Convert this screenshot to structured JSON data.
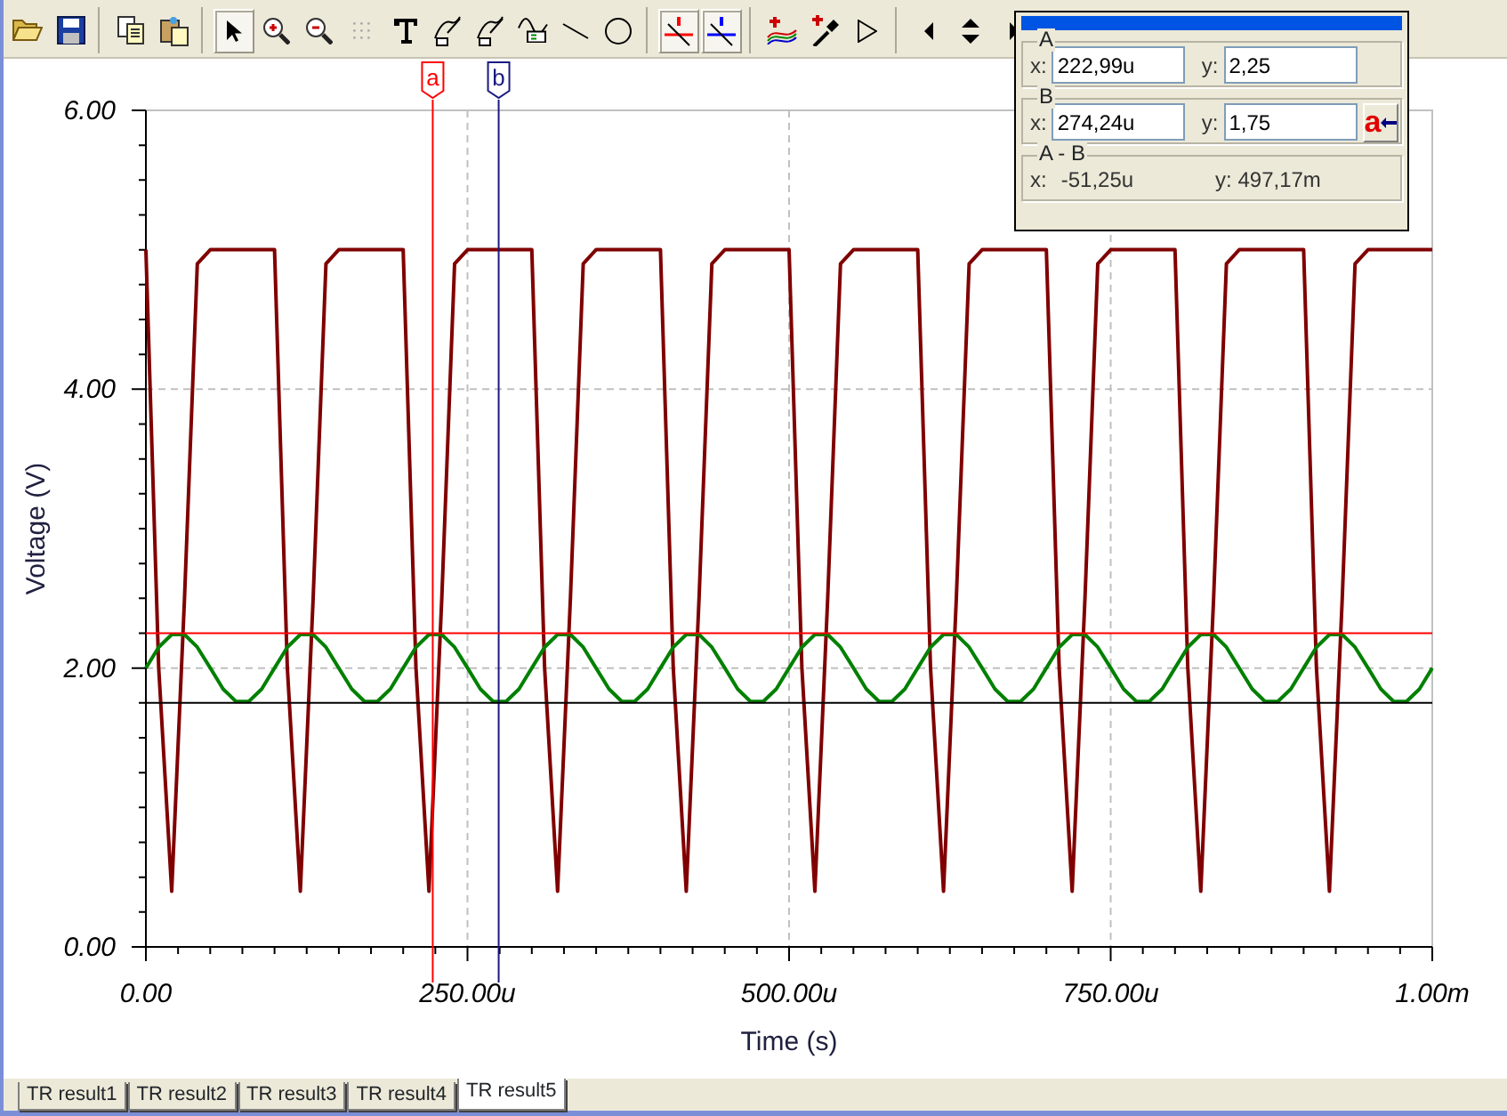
{
  "toolbar": [
    {
      "kind": "open",
      "selected": false
    },
    {
      "kind": "save",
      "selected": false
    },
    {
      "kind": "separator"
    },
    {
      "kind": "copy",
      "selected": false
    },
    {
      "kind": "paste",
      "selected": false
    },
    {
      "kind": "separator"
    },
    {
      "kind": "pointer",
      "selected": true
    },
    {
      "kind": "zoom-in",
      "selected": false
    },
    {
      "kind": "zoom-out",
      "selected": false
    },
    {
      "kind": "grid",
      "selected": false
    },
    {
      "kind": "text",
      "selected": false
    },
    {
      "kind": "label",
      "selected": false
    },
    {
      "kind": "label",
      "selected": false
    },
    {
      "kind": "label-wave",
      "selected": false
    },
    {
      "kind": "line",
      "selected": false
    },
    {
      "kind": "circle",
      "selected": false
    },
    {
      "kind": "separator"
    },
    {
      "kind": "cursor-a",
      "selected": true
    },
    {
      "kind": "cursor-b",
      "selected": true
    },
    {
      "kind": "separator"
    },
    {
      "kind": "add-trace",
      "selected": false
    },
    {
      "kind": "probe",
      "selected": false
    },
    {
      "kind": "triangle",
      "selected": false
    },
    {
      "kind": "separator"
    },
    {
      "kind": "left",
      "selected": false
    },
    {
      "kind": "updown",
      "selected": false
    },
    {
      "kind": "right",
      "selected": false
    }
  ],
  "cursor_panel": {
    "groups": [
      {
        "kind": "fields",
        "title": "A",
        "x_label": "x:",
        "x_value": "222,99u",
        "y_label": "y:",
        "y_value": "2,25"
      },
      {
        "kind": "fields",
        "title": "B",
        "x_label": "x:",
        "x_value": "274,24u",
        "y_label": "y:",
        "y_value": "1,75",
        "button": "a"
      },
      {
        "kind": "readout",
        "title": "A - B",
        "x_label": "x:",
        "x_value": "-51,25u",
        "y_label": "y:",
        "y_value": "497,17m"
      }
    ]
  },
  "chart": {
    "x_axis_end_label": "1.00m",
    "chart_data": {
      "type": "line",
      "xlabel": "Time (s)",
      "ylabel": "Voltage (V)",
      "x": [
        0,
        10,
        20,
        30,
        40,
        50,
        60,
        70,
        80,
        90,
        100,
        110,
        120,
        130,
        140,
        150,
        160,
        170,
        180,
        190,
        200,
        210,
        220,
        230,
        240,
        250,
        260,
        270,
        280,
        290,
        300,
        310,
        320,
        330,
        340,
        350,
        360,
        370,
        380,
        390,
        400,
        410,
        420,
        430,
        440,
        450,
        460,
        470,
        480,
        490,
        500,
        510,
        520,
        530,
        540,
        550,
        560,
        570,
        580,
        590,
        600,
        610,
        620,
        630,
        640,
        650,
        660,
        670,
        680,
        690,
        700,
        710,
        720,
        730,
        740,
        750,
        760,
        770,
        780,
        790,
        800,
        810,
        820,
        830,
        840,
        850,
        860,
        870,
        880,
        890,
        900,
        910,
        920,
        930,
        940,
        950,
        960,
        970,
        980,
        990,
        1000
      ],
      "series": [
        {
          "color": "#800000",
          "values": [
            5,
            2,
            0.4,
            2.5,
            4.9,
            5,
            5,
            5,
            5,
            5,
            5,
            2,
            0.4,
            2.5,
            4.9,
            5,
            5,
            5,
            5,
            5,
            5,
            2,
            0.4,
            2.5,
            4.9,
            5,
            5,
            5,
            5,
            5,
            5,
            2,
            0.4,
            2.5,
            4.9,
            5,
            5,
            5,
            5,
            5,
            5,
            2,
            0.4,
            2.5,
            4.9,
            5,
            5,
            5,
            5,
            5,
            5,
            2,
            0.4,
            2.5,
            4.9,
            5,
            5,
            5,
            5,
            5,
            5,
            2,
            0.4,
            2.5,
            4.9,
            5,
            5,
            5,
            5,
            5,
            5,
            2,
            0.4,
            2.5,
            4.9,
            5,
            5,
            5,
            5,
            5,
            5,
            2,
            0.4,
            2.5,
            4.9,
            5,
            5,
            5,
            5,
            5,
            5,
            2,
            0.4,
            2.5,
            4.9,
            5,
            5,
            5,
            5,
            5,
            5
          ]
        },
        {
          "color": "#008000",
          "values": [
            2,
            2.15,
            2.24,
            2.24,
            2.15,
            2,
            1.85,
            1.76,
            1.76,
            1.85,
            2,
            2.15,
            2.24,
            2.24,
            2.15,
            2,
            1.85,
            1.76,
            1.76,
            1.85,
            2,
            2.15,
            2.24,
            2.24,
            2.15,
            2,
            1.85,
            1.76,
            1.76,
            1.85,
            2,
            2.15,
            2.24,
            2.24,
            2.15,
            2,
            1.85,
            1.76,
            1.76,
            1.85,
            2,
            2.15,
            2.24,
            2.24,
            2.15,
            2,
            1.85,
            1.76,
            1.76,
            1.85,
            2,
            2.15,
            2.24,
            2.24,
            2.15,
            2,
            1.85,
            1.76,
            1.76,
            1.85,
            2,
            2.15,
            2.24,
            2.24,
            2.15,
            2,
            1.85,
            1.76,
            1.76,
            1.85,
            2,
            2.15,
            2.24,
            2.24,
            2.15,
            2,
            1.85,
            1.76,
            1.76,
            1.85,
            2,
            2.15,
            2.24,
            2.24,
            2.15,
            2,
            1.85,
            1.76,
            1.76,
            1.85,
            2,
            2.15,
            2.24,
            2.24,
            2.15,
            2,
            1.85,
            1.76,
            1.76,
            1.85,
            2
          ]
        }
      ],
      "xlim": [
        0,
        1000
      ],
      "ylim": [
        0,
        6
      ],
      "grid": true,
      "xticks": [
        {
          "value": 0,
          "label": "0.00"
        },
        {
          "value": 250,
          "label": "250.00u"
        },
        {
          "value": 500,
          "label": "500.00u"
        },
        {
          "value": 750,
          "label": "750.00u"
        }
      ],
      "yticks": [
        {
          "value": 0,
          "label": "0.00"
        },
        {
          "value": 2,
          "label": "2.00"
        },
        {
          "value": 4,
          "label": "4.00"
        },
        {
          "value": 6,
          "label": "6.00"
        }
      ],
      "ref_lines": [
        {
          "axis": "x",
          "value": 222.99,
          "label": "a",
          "color": "#ff0000"
        },
        {
          "axis": "x",
          "value": 274.24,
          "label": "b",
          "color": "#1a1a80"
        },
        {
          "axis": "y",
          "value": 2.25,
          "color": "#ff0000"
        },
        {
          "axis": "y",
          "value": 1.75,
          "color": "#000000"
        }
      ]
    }
  },
  "tabs": [
    {
      "label": "TR result1",
      "selected": false
    },
    {
      "label": "TR result2",
      "selected": false
    },
    {
      "label": "TR result3",
      "selected": false
    },
    {
      "label": "TR result4",
      "selected": false
    },
    {
      "label": "TR result5",
      "selected": true
    }
  ]
}
